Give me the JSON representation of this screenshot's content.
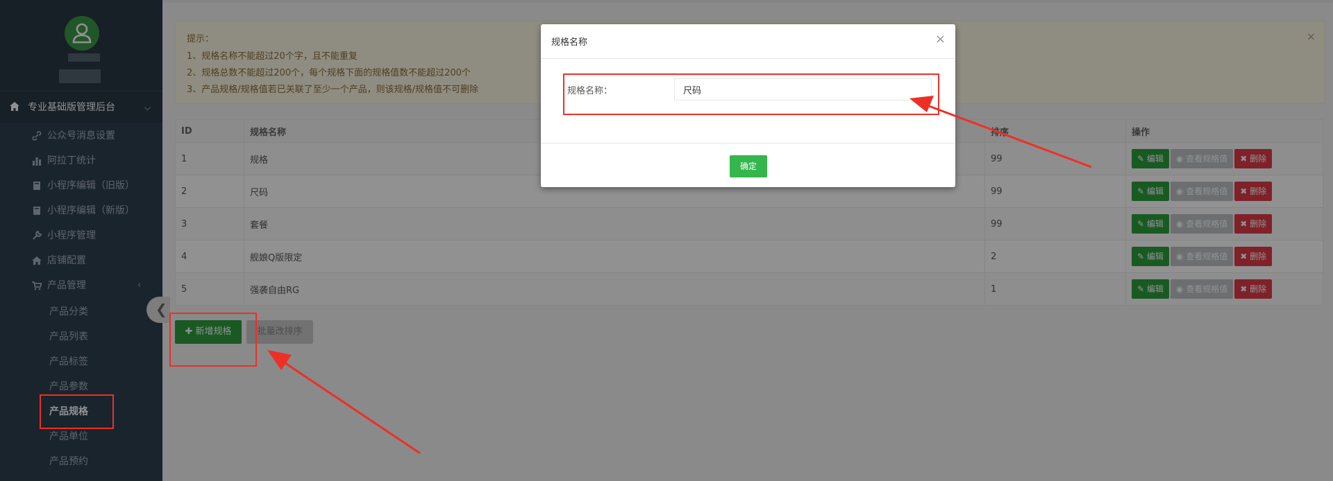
{
  "sidebar": {
    "nav_head_label": "专业基础版管理后台",
    "items": [
      {
        "label": "公众号消息设置",
        "icon": "link-icon"
      },
      {
        "label": "阿拉丁统计",
        "icon": "bar-chart-icon"
      },
      {
        "label": "小程序编辑（旧版）",
        "icon": "book-icon"
      },
      {
        "label": "小程序编辑（新版）",
        "icon": "book-icon"
      },
      {
        "label": "小程序管理",
        "icon": "wrench-icon"
      },
      {
        "label": "店铺配置",
        "icon": "home-icon"
      },
      {
        "label": "产品管理",
        "icon": "cart-icon"
      }
    ],
    "sub_items": [
      {
        "label": "产品分类"
      },
      {
        "label": "产品列表"
      },
      {
        "label": "产品标签"
      },
      {
        "label": "产品参数"
      },
      {
        "label": "产品规格",
        "active": true
      },
      {
        "label": "产品单位"
      },
      {
        "label": "产品预约"
      }
    ]
  },
  "alert": {
    "lines": [
      "提示：",
      "1、规格名称不能超过20个字，且不能重复",
      "2、规格总数不能超过200个，每个规格下面的规格值数不能超过200个",
      "3、产品规格/规格值若已关联了至少一个产品，则该规格/规格值不可删除"
    ],
    "close": "×"
  },
  "table": {
    "columns": [
      "ID",
      "规格名称",
      "排序",
      "操作"
    ],
    "rows": [
      {
        "id": "1",
        "name": "规格",
        "sort": "99"
      },
      {
        "id": "2",
        "name": "尺码",
        "sort": "99"
      },
      {
        "id": "3",
        "name": "套餐",
        "sort": "99"
      },
      {
        "id": "4",
        "name": "舰娘Q版限定",
        "sort": "2"
      },
      {
        "id": "5",
        "name": "强袭自由RG",
        "sort": "1"
      }
    ],
    "actions": {
      "edit": "编辑",
      "view": "查看规格值",
      "delete": "删除"
    }
  },
  "buttons": {
    "add": "新增规格",
    "batch_sort": "批量改排序"
  },
  "modal": {
    "title": "规格名称",
    "close": "×",
    "field_label": "规格名称：",
    "field_value": "尺码",
    "ok": "确定"
  },
  "colors": {
    "annotation": "#ee2f25",
    "primary_green": "#2c9f3e",
    "danger": "#e03a48",
    "sidebar": "#2f4050"
  }
}
